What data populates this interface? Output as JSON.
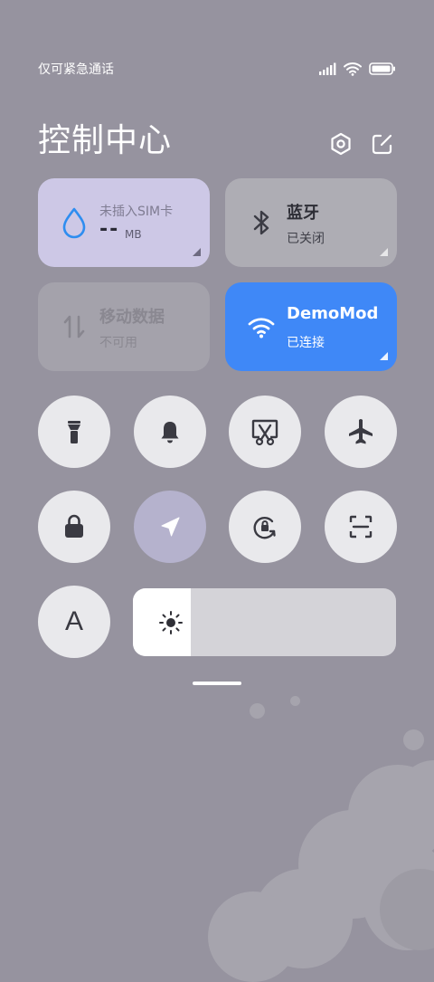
{
  "status_bar": {
    "carrier_text": "仅可紧急通话",
    "icons": [
      "signal-icon",
      "wifi-icon",
      "battery-icon"
    ]
  },
  "header": {
    "title": "控制中心",
    "icons": [
      "settings-icon",
      "edit-icon"
    ]
  },
  "tiles": {
    "data_usage": {
      "label": "未插入SIM卡",
      "value": "--",
      "unit": "MB",
      "icon": "water-drop-icon"
    },
    "bluetooth": {
      "label": "蓝牙",
      "status": "已关闭",
      "icon": "bluetooth-icon"
    },
    "mobile_data": {
      "label": "移动数据",
      "status": "不可用",
      "icon": "data-arrows-icon"
    },
    "wifi": {
      "label": "DemoMod",
      "status": "已连接",
      "icon": "wifi-icon"
    }
  },
  "toggles_row1": [
    "flashlight-icon",
    "bell-icon",
    "screenshot-icon",
    "airplane-icon"
  ],
  "toggles_row2": [
    "lock-icon",
    "location-icon",
    "rotation-lock-icon",
    "scan-icon"
  ],
  "font_toggle": {
    "label": "A"
  },
  "brightness": {
    "icon": "sun-icon",
    "level_percent": 22
  },
  "colors": {
    "background": "#96939f",
    "data_tile": "#cdc8e6",
    "wifi_tile": "#3f88f7",
    "inactive_tile": "#aeadb4",
    "toggle_bg": "#e9e9ec",
    "location_active": "#b5b2cd"
  }
}
